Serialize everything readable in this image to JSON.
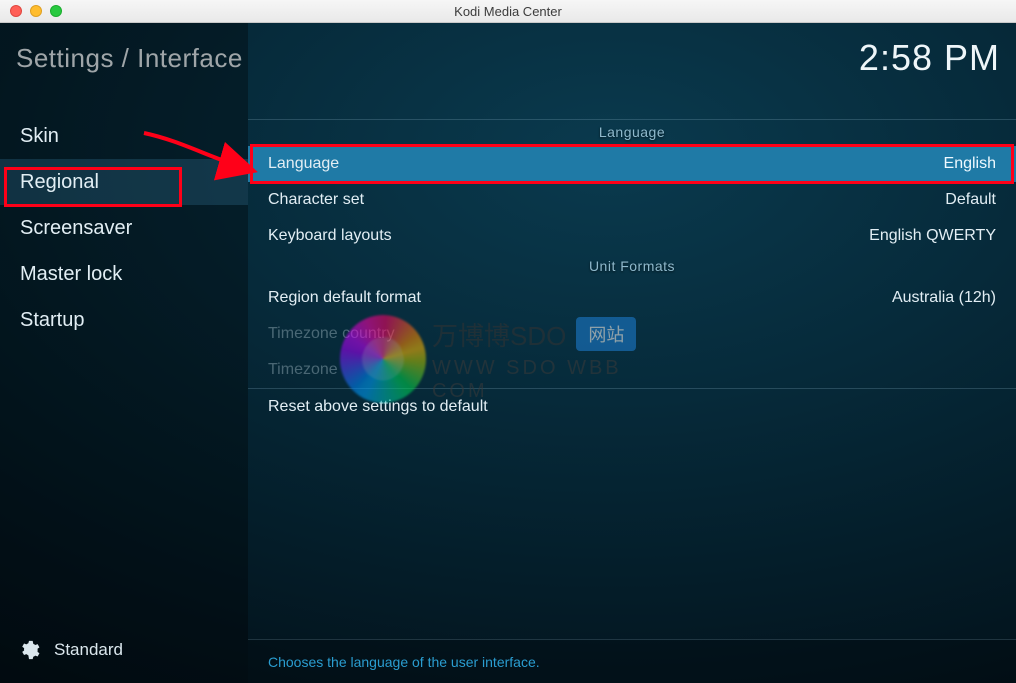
{
  "window": {
    "title": "Kodi Media Center"
  },
  "header": {
    "breadcrumb": "Settings / Interface",
    "clock": "2:58 PM"
  },
  "sidebar": {
    "items": [
      {
        "label": "Skin"
      },
      {
        "label": "Regional"
      },
      {
        "label": "Screensaver"
      },
      {
        "label": "Master lock"
      },
      {
        "label": "Startup"
      }
    ],
    "active_index": 1,
    "level_label": "Standard"
  },
  "sections": [
    {
      "heading": "Language",
      "rows": [
        {
          "label": "Language",
          "value": "English",
          "selected": true
        },
        {
          "label": "Character set",
          "value": "Default"
        },
        {
          "label": "Keyboard layouts",
          "value": "English QWERTY"
        }
      ]
    },
    {
      "heading": "Unit Formats",
      "rows": [
        {
          "label": "Region default format",
          "value": "Australia (12h)"
        },
        {
          "label": "Timezone country",
          "value": "",
          "disabled": true
        },
        {
          "label": "Timezone",
          "value": "",
          "disabled": true
        }
      ]
    }
  ],
  "reset_label": "Reset above settings to default",
  "hint": "Chooses the language of the user interface.",
  "watermark": {
    "text1": "万博博SDO",
    "badge": "网站",
    "text2": "WWW  SDO  WBB  COM"
  }
}
